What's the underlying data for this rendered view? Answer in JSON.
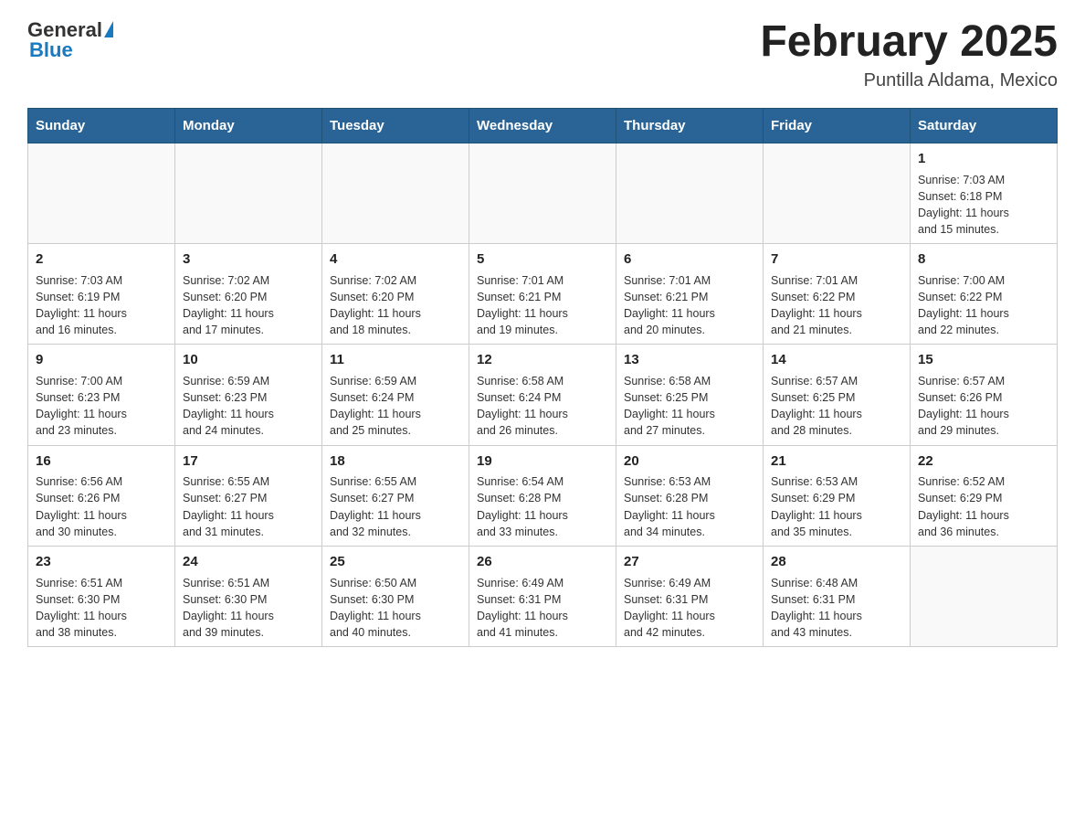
{
  "header": {
    "logo_general": "General",
    "logo_blue": "Blue",
    "title": "February 2025",
    "subtitle": "Puntilla Aldama, Mexico"
  },
  "weekdays": [
    "Sunday",
    "Monday",
    "Tuesday",
    "Wednesday",
    "Thursday",
    "Friday",
    "Saturday"
  ],
  "weeks": [
    [
      {
        "day": "",
        "lines": []
      },
      {
        "day": "",
        "lines": []
      },
      {
        "day": "",
        "lines": []
      },
      {
        "day": "",
        "lines": []
      },
      {
        "day": "",
        "lines": []
      },
      {
        "day": "",
        "lines": []
      },
      {
        "day": "1",
        "lines": [
          "Sunrise: 7:03 AM",
          "Sunset: 6:18 PM",
          "Daylight: 11 hours",
          "and 15 minutes."
        ]
      }
    ],
    [
      {
        "day": "2",
        "lines": [
          "Sunrise: 7:03 AM",
          "Sunset: 6:19 PM",
          "Daylight: 11 hours",
          "and 16 minutes."
        ]
      },
      {
        "day": "3",
        "lines": [
          "Sunrise: 7:02 AM",
          "Sunset: 6:20 PM",
          "Daylight: 11 hours",
          "and 17 minutes."
        ]
      },
      {
        "day": "4",
        "lines": [
          "Sunrise: 7:02 AM",
          "Sunset: 6:20 PM",
          "Daylight: 11 hours",
          "and 18 minutes."
        ]
      },
      {
        "day": "5",
        "lines": [
          "Sunrise: 7:01 AM",
          "Sunset: 6:21 PM",
          "Daylight: 11 hours",
          "and 19 minutes."
        ]
      },
      {
        "day": "6",
        "lines": [
          "Sunrise: 7:01 AM",
          "Sunset: 6:21 PM",
          "Daylight: 11 hours",
          "and 20 minutes."
        ]
      },
      {
        "day": "7",
        "lines": [
          "Sunrise: 7:01 AM",
          "Sunset: 6:22 PM",
          "Daylight: 11 hours",
          "and 21 minutes."
        ]
      },
      {
        "day": "8",
        "lines": [
          "Sunrise: 7:00 AM",
          "Sunset: 6:22 PM",
          "Daylight: 11 hours",
          "and 22 minutes."
        ]
      }
    ],
    [
      {
        "day": "9",
        "lines": [
          "Sunrise: 7:00 AM",
          "Sunset: 6:23 PM",
          "Daylight: 11 hours",
          "and 23 minutes."
        ]
      },
      {
        "day": "10",
        "lines": [
          "Sunrise: 6:59 AM",
          "Sunset: 6:23 PM",
          "Daylight: 11 hours",
          "and 24 minutes."
        ]
      },
      {
        "day": "11",
        "lines": [
          "Sunrise: 6:59 AM",
          "Sunset: 6:24 PM",
          "Daylight: 11 hours",
          "and 25 minutes."
        ]
      },
      {
        "day": "12",
        "lines": [
          "Sunrise: 6:58 AM",
          "Sunset: 6:24 PM",
          "Daylight: 11 hours",
          "and 26 minutes."
        ]
      },
      {
        "day": "13",
        "lines": [
          "Sunrise: 6:58 AM",
          "Sunset: 6:25 PM",
          "Daylight: 11 hours",
          "and 27 minutes."
        ]
      },
      {
        "day": "14",
        "lines": [
          "Sunrise: 6:57 AM",
          "Sunset: 6:25 PM",
          "Daylight: 11 hours",
          "and 28 minutes."
        ]
      },
      {
        "day": "15",
        "lines": [
          "Sunrise: 6:57 AM",
          "Sunset: 6:26 PM",
          "Daylight: 11 hours",
          "and 29 minutes."
        ]
      }
    ],
    [
      {
        "day": "16",
        "lines": [
          "Sunrise: 6:56 AM",
          "Sunset: 6:26 PM",
          "Daylight: 11 hours",
          "and 30 minutes."
        ]
      },
      {
        "day": "17",
        "lines": [
          "Sunrise: 6:55 AM",
          "Sunset: 6:27 PM",
          "Daylight: 11 hours",
          "and 31 minutes."
        ]
      },
      {
        "day": "18",
        "lines": [
          "Sunrise: 6:55 AM",
          "Sunset: 6:27 PM",
          "Daylight: 11 hours",
          "and 32 minutes."
        ]
      },
      {
        "day": "19",
        "lines": [
          "Sunrise: 6:54 AM",
          "Sunset: 6:28 PM",
          "Daylight: 11 hours",
          "and 33 minutes."
        ]
      },
      {
        "day": "20",
        "lines": [
          "Sunrise: 6:53 AM",
          "Sunset: 6:28 PM",
          "Daylight: 11 hours",
          "and 34 minutes."
        ]
      },
      {
        "day": "21",
        "lines": [
          "Sunrise: 6:53 AM",
          "Sunset: 6:29 PM",
          "Daylight: 11 hours",
          "and 35 minutes."
        ]
      },
      {
        "day": "22",
        "lines": [
          "Sunrise: 6:52 AM",
          "Sunset: 6:29 PM",
          "Daylight: 11 hours",
          "and 36 minutes."
        ]
      }
    ],
    [
      {
        "day": "23",
        "lines": [
          "Sunrise: 6:51 AM",
          "Sunset: 6:30 PM",
          "Daylight: 11 hours",
          "and 38 minutes."
        ]
      },
      {
        "day": "24",
        "lines": [
          "Sunrise: 6:51 AM",
          "Sunset: 6:30 PM",
          "Daylight: 11 hours",
          "and 39 minutes."
        ]
      },
      {
        "day": "25",
        "lines": [
          "Sunrise: 6:50 AM",
          "Sunset: 6:30 PM",
          "Daylight: 11 hours",
          "and 40 minutes."
        ]
      },
      {
        "day": "26",
        "lines": [
          "Sunrise: 6:49 AM",
          "Sunset: 6:31 PM",
          "Daylight: 11 hours",
          "and 41 minutes."
        ]
      },
      {
        "day": "27",
        "lines": [
          "Sunrise: 6:49 AM",
          "Sunset: 6:31 PM",
          "Daylight: 11 hours",
          "and 42 minutes."
        ]
      },
      {
        "day": "28",
        "lines": [
          "Sunrise: 6:48 AM",
          "Sunset: 6:31 PM",
          "Daylight: 11 hours",
          "and 43 minutes."
        ]
      },
      {
        "day": "",
        "lines": []
      }
    ]
  ]
}
